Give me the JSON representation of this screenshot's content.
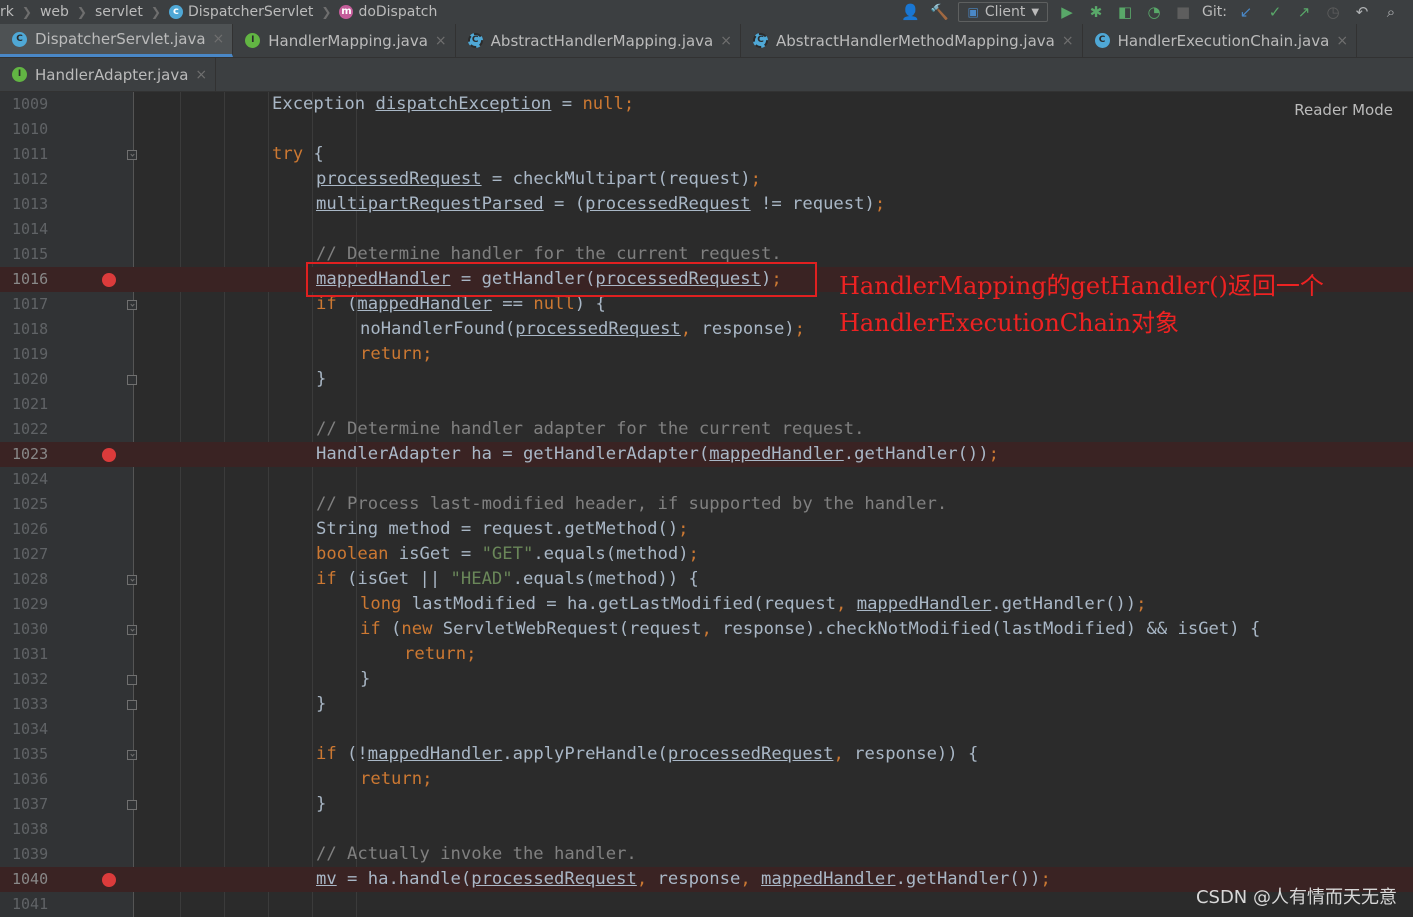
{
  "breadcrumb": {
    "items": [
      "rk",
      "web",
      "servlet",
      "DispatcherServlet",
      "doDispatch"
    ]
  },
  "toolbar": {
    "run_config": "Client",
    "git_label": "Git:"
  },
  "tabs_row1": [
    {
      "label": "DispatcherServlet.java",
      "kind": "class",
      "active": true
    },
    {
      "label": "HandlerMapping.java",
      "kind": "interface",
      "active": false
    },
    {
      "label": "AbstractHandlerMapping.java",
      "kind": "abstract",
      "active": false
    },
    {
      "label": "AbstractHandlerMethodMapping.java",
      "kind": "abstract",
      "active": false
    },
    {
      "label": "HandlerExecutionChain.java",
      "kind": "class",
      "active": false
    }
  ],
  "tabs_row2": [
    {
      "label": "HandlerAdapter.java",
      "kind": "interface",
      "active": false
    }
  ],
  "reader_mode": "Reader Mode",
  "annotation": {
    "line1": "HandlerMapping的getHandler()返回一个",
    "line2": "HandlerExecutionChain对象"
  },
  "watermark": "CSDN @人有情而天无意",
  "code_lines": [
    {
      "num": "1009",
      "indent": 0,
      "bp": false,
      "fold": "",
      "tokens": [
        [
          "t",
          "Exception "
        ],
        [
          "v",
          "dispatchException"
        ],
        [
          "t",
          " = "
        ],
        [
          "n",
          "null"
        ],
        [
          "p",
          ";"
        ]
      ]
    },
    {
      "num": "1010",
      "indent": 0,
      "bp": false,
      "fold": "",
      "tokens": []
    },
    {
      "num": "1011",
      "indent": 0,
      "bp": false,
      "fold": "open",
      "tokens": [
        [
          "k",
          "try"
        ],
        [
          "t",
          " {"
        ]
      ]
    },
    {
      "num": "1012",
      "indent": 1,
      "bp": false,
      "fold": "",
      "tokens": [
        [
          "v",
          "processedRequest"
        ],
        [
          "t",
          " = checkMultipart(request)"
        ],
        [
          "p",
          ";"
        ]
      ]
    },
    {
      "num": "1013",
      "indent": 1,
      "bp": false,
      "fold": "",
      "tokens": [
        [
          "v",
          "multipartRequestParsed"
        ],
        [
          "t",
          " = ("
        ],
        [
          "v",
          "processedRequest"
        ],
        [
          "t",
          " != request)"
        ],
        [
          "p",
          ";"
        ]
      ]
    },
    {
      "num": "1014",
      "indent": 0,
      "bp": false,
      "fold": "",
      "tokens": []
    },
    {
      "num": "1015",
      "indent": 1,
      "bp": false,
      "fold": "",
      "tokens": [
        [
          "c",
          "// Determine handler for the current request."
        ]
      ]
    },
    {
      "num": "1016",
      "indent": 1,
      "bp": true,
      "fold": "",
      "tokens": [
        [
          "v",
          "mappedHandler"
        ],
        [
          "t",
          " = getHandler("
        ],
        [
          "v",
          "processedRequest"
        ],
        [
          "t",
          ")"
        ],
        [
          "p",
          ";"
        ]
      ]
    },
    {
      "num": "1017",
      "indent": 1,
      "bp": false,
      "fold": "open",
      "tokens": [
        [
          "k",
          "if"
        ],
        [
          "t",
          " ("
        ],
        [
          "v",
          "mappedHandler"
        ],
        [
          "t",
          " == "
        ],
        [
          "n",
          "null"
        ],
        [
          "t",
          ") {"
        ]
      ]
    },
    {
      "num": "1018",
      "indent": 2,
      "bp": false,
      "fold": "",
      "tokens": [
        [
          "t",
          "noHandlerFound("
        ],
        [
          "v",
          "processedRequest"
        ],
        [
          "p",
          ","
        ],
        [
          "t",
          " response)"
        ],
        [
          "p",
          ";"
        ]
      ]
    },
    {
      "num": "1019",
      "indent": 2,
      "bp": false,
      "fold": "",
      "tokens": [
        [
          "k",
          "return"
        ],
        [
          "p",
          ";"
        ]
      ]
    },
    {
      "num": "1020",
      "indent": 1,
      "bp": false,
      "fold": "close",
      "tokens": [
        [
          "t",
          "}"
        ]
      ]
    },
    {
      "num": "1021",
      "indent": 0,
      "bp": false,
      "fold": "",
      "tokens": []
    },
    {
      "num": "1022",
      "indent": 1,
      "bp": false,
      "fold": "",
      "tokens": [
        [
          "c",
          "// Determine handler adapter for the current request."
        ]
      ]
    },
    {
      "num": "1023",
      "indent": 1,
      "bp": true,
      "fold": "",
      "tokens": [
        [
          "t",
          "HandlerAdapter ha = getHandlerAdapter("
        ],
        [
          "v",
          "mappedHandler"
        ],
        [
          "t",
          ".getHandler())"
        ],
        [
          "p",
          ";"
        ]
      ]
    },
    {
      "num": "1024",
      "indent": 0,
      "bp": false,
      "fold": "",
      "tokens": []
    },
    {
      "num": "1025",
      "indent": 1,
      "bp": false,
      "fold": "",
      "tokens": [
        [
          "c",
          "// Process last-modified header, if supported by the handler."
        ]
      ]
    },
    {
      "num": "1026",
      "indent": 1,
      "bp": false,
      "fold": "",
      "tokens": [
        [
          "t",
          "String method = request.getMethod()"
        ],
        [
          "p",
          ";"
        ]
      ]
    },
    {
      "num": "1027",
      "indent": 1,
      "bp": false,
      "fold": "",
      "tokens": [
        [
          "k",
          "boolean"
        ],
        [
          "t",
          " isGet = "
        ],
        [
          "s",
          "\"GET\""
        ],
        [
          "t",
          ".equals(method)"
        ],
        [
          "p",
          ";"
        ]
      ]
    },
    {
      "num": "1028",
      "indent": 1,
      "bp": false,
      "fold": "open",
      "tokens": [
        [
          "k",
          "if"
        ],
        [
          "t",
          " (isGet || "
        ],
        [
          "s",
          "\"HEAD\""
        ],
        [
          "t",
          ".equals(method)) {"
        ]
      ]
    },
    {
      "num": "1029",
      "indent": 2,
      "bp": false,
      "fold": "",
      "tokens": [
        [
          "k",
          "long"
        ],
        [
          "t",
          " lastModified = ha.getLastModified(request"
        ],
        [
          "p",
          ","
        ],
        [
          "t",
          " "
        ],
        [
          "v",
          "mappedHandler"
        ],
        [
          "t",
          ".getHandler())"
        ],
        [
          "p",
          ";"
        ]
      ]
    },
    {
      "num": "1030",
      "indent": 2,
      "bp": false,
      "fold": "open",
      "tokens": [
        [
          "k",
          "if"
        ],
        [
          "t",
          " ("
        ],
        [
          "k",
          "new"
        ],
        [
          "t",
          " ServletWebRequest(request"
        ],
        [
          "p",
          ","
        ],
        [
          "t",
          " response).checkNotModified(lastModified) && isGet) {"
        ]
      ]
    },
    {
      "num": "1031",
      "indent": 3,
      "bp": false,
      "fold": "",
      "tokens": [
        [
          "k",
          "return"
        ],
        [
          "p",
          ";"
        ]
      ]
    },
    {
      "num": "1032",
      "indent": 2,
      "bp": false,
      "fold": "close",
      "tokens": [
        [
          "t",
          "}"
        ]
      ]
    },
    {
      "num": "1033",
      "indent": 1,
      "bp": false,
      "fold": "close",
      "tokens": [
        [
          "t",
          "}"
        ]
      ]
    },
    {
      "num": "1034",
      "indent": 0,
      "bp": false,
      "fold": "",
      "tokens": []
    },
    {
      "num": "1035",
      "indent": 1,
      "bp": false,
      "fold": "open",
      "tokens": [
        [
          "k",
          "if"
        ],
        [
          "t",
          " (!"
        ],
        [
          "v",
          "mappedHandler"
        ],
        [
          "t",
          ".applyPreHandle("
        ],
        [
          "v",
          "processedRequest"
        ],
        [
          "p",
          ","
        ],
        [
          "t",
          " response)) {"
        ]
      ]
    },
    {
      "num": "1036",
      "indent": 2,
      "bp": false,
      "fold": "",
      "tokens": [
        [
          "k",
          "return"
        ],
        [
          "p",
          ";"
        ]
      ]
    },
    {
      "num": "1037",
      "indent": 1,
      "bp": false,
      "fold": "close",
      "tokens": [
        [
          "t",
          "}"
        ]
      ]
    },
    {
      "num": "1038",
      "indent": 0,
      "bp": false,
      "fold": "",
      "tokens": []
    },
    {
      "num": "1039",
      "indent": 1,
      "bp": false,
      "fold": "",
      "tokens": [
        [
          "c",
          "// Actually invoke the handler."
        ]
      ]
    },
    {
      "num": "1040",
      "indent": 1,
      "bp": true,
      "fold": "",
      "tokens": [
        [
          "v",
          "mv"
        ],
        [
          "t",
          " = ha.handle("
        ],
        [
          "v",
          "processedRequest"
        ],
        [
          "p",
          ","
        ],
        [
          "t",
          " response"
        ],
        [
          "p",
          ","
        ],
        [
          "t",
          " "
        ],
        [
          "v",
          "mappedHandler"
        ],
        [
          "t",
          ".getHandler())"
        ],
        [
          "p",
          ";"
        ]
      ]
    },
    {
      "num": "1041",
      "indent": 0,
      "bp": false,
      "fold": "",
      "tokens": []
    }
  ]
}
